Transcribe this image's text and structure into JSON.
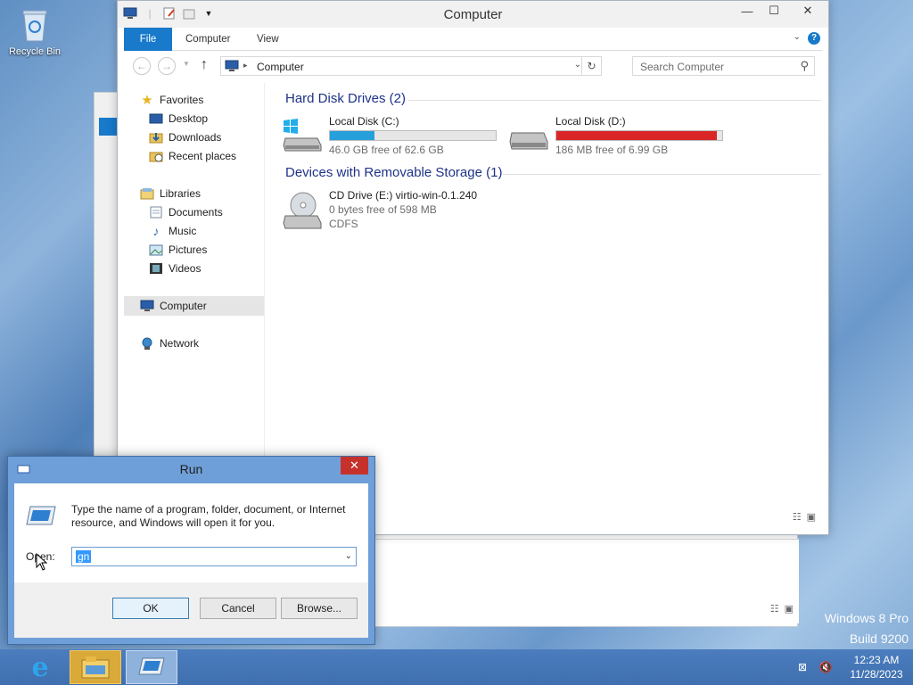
{
  "desktop": {
    "recycle_bin_label": "Recycle Bin",
    "watermark_line1": "Windows 8 Pro",
    "watermark_line2": "Build 9200"
  },
  "explorer": {
    "title": "Computer",
    "ribbon_tabs": [
      "File",
      "Computer",
      "View"
    ],
    "address": "Computer",
    "search_placeholder": "Search Computer",
    "nav": {
      "favorites": "Favorites",
      "desktop": "Desktop",
      "downloads": "Downloads",
      "recent_places": "Recent places",
      "libraries": "Libraries",
      "documents": "Documents",
      "music": "Music",
      "pictures": "Pictures",
      "videos": "Videos",
      "computer": "Computer",
      "network": "Network"
    },
    "groups": {
      "hard_disks": "Hard Disk Drives (2)",
      "removable": "Devices with Removable Storage (1)"
    },
    "drives": [
      {
        "name": "Local Disk (C:)",
        "free": "46.0 GB free of 62.6 GB",
        "used_fraction": 0.27,
        "bar_color": "#26a0da"
      },
      {
        "name": "Local Disk (D:)",
        "free": "186 MB free of 6.99 GB",
        "used_fraction": 0.97,
        "bar_color": "#da2626"
      }
    ],
    "cd_drive": {
      "name": "CD Drive (E:) virtio-win-0.1.240",
      "free": "0 bytes free of 598 MB",
      "fs": "CDFS"
    }
  },
  "run": {
    "title": "Run",
    "description": "Type the name of a program, folder, document, or Internet resource, and Windows will open it for you.",
    "open_label": "Open:",
    "open_value": "gn",
    "ok": "OK",
    "cancel": "Cancel",
    "browse": "Browse..."
  },
  "taskbar": {
    "time": "12:23 AM",
    "date": "11/28/2023"
  },
  "colors": {
    "accent": "#1979ca",
    "group_heading": "#1e3287",
    "close_red": "#c7312c"
  }
}
